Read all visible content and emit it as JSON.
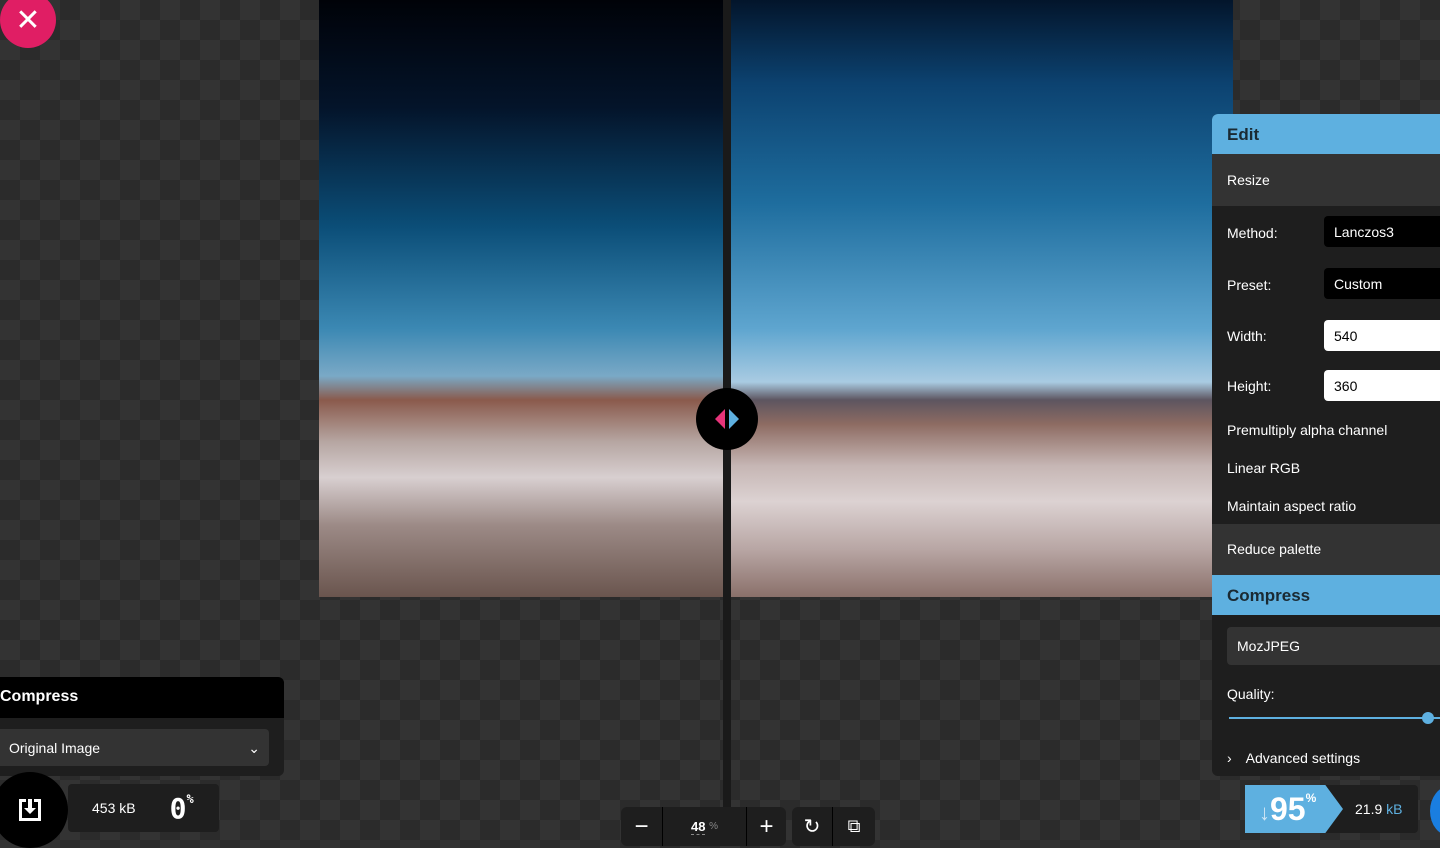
{
  "close_icon": "close-icon",
  "left": {
    "header": "Compress",
    "select": "Original Image",
    "size": "453 kB",
    "percent": "0",
    "percent_unit": "%"
  },
  "zoom": {
    "value": "48",
    "unit": "%",
    "minus": "−",
    "plus": "+"
  },
  "right": {
    "edit_title": "Edit",
    "resize": "Resize",
    "method_label": "Method:",
    "method": "Lanczos3",
    "preset_label": "Preset:",
    "preset": "Custom",
    "width_label": "Width:",
    "width": "540",
    "height_label": "Height:",
    "height": "360",
    "premultiply": "Premultiply alpha channel",
    "linear_rgb": "Linear RGB",
    "maintain": "Maintain aspect ratio",
    "reduce_palette": "Reduce palette",
    "compress_title": "Compress",
    "codec": "MozJPEG",
    "quality_label": "Quality:",
    "quality": 75,
    "advanced": "Advanced settings",
    "percent": "95",
    "percent_unit": "%",
    "arrow": "↓",
    "size": "21.9",
    "size_unit": "kB"
  },
  "colors": {
    "accent": "#5eb0e0",
    "close": "#e01e64"
  }
}
